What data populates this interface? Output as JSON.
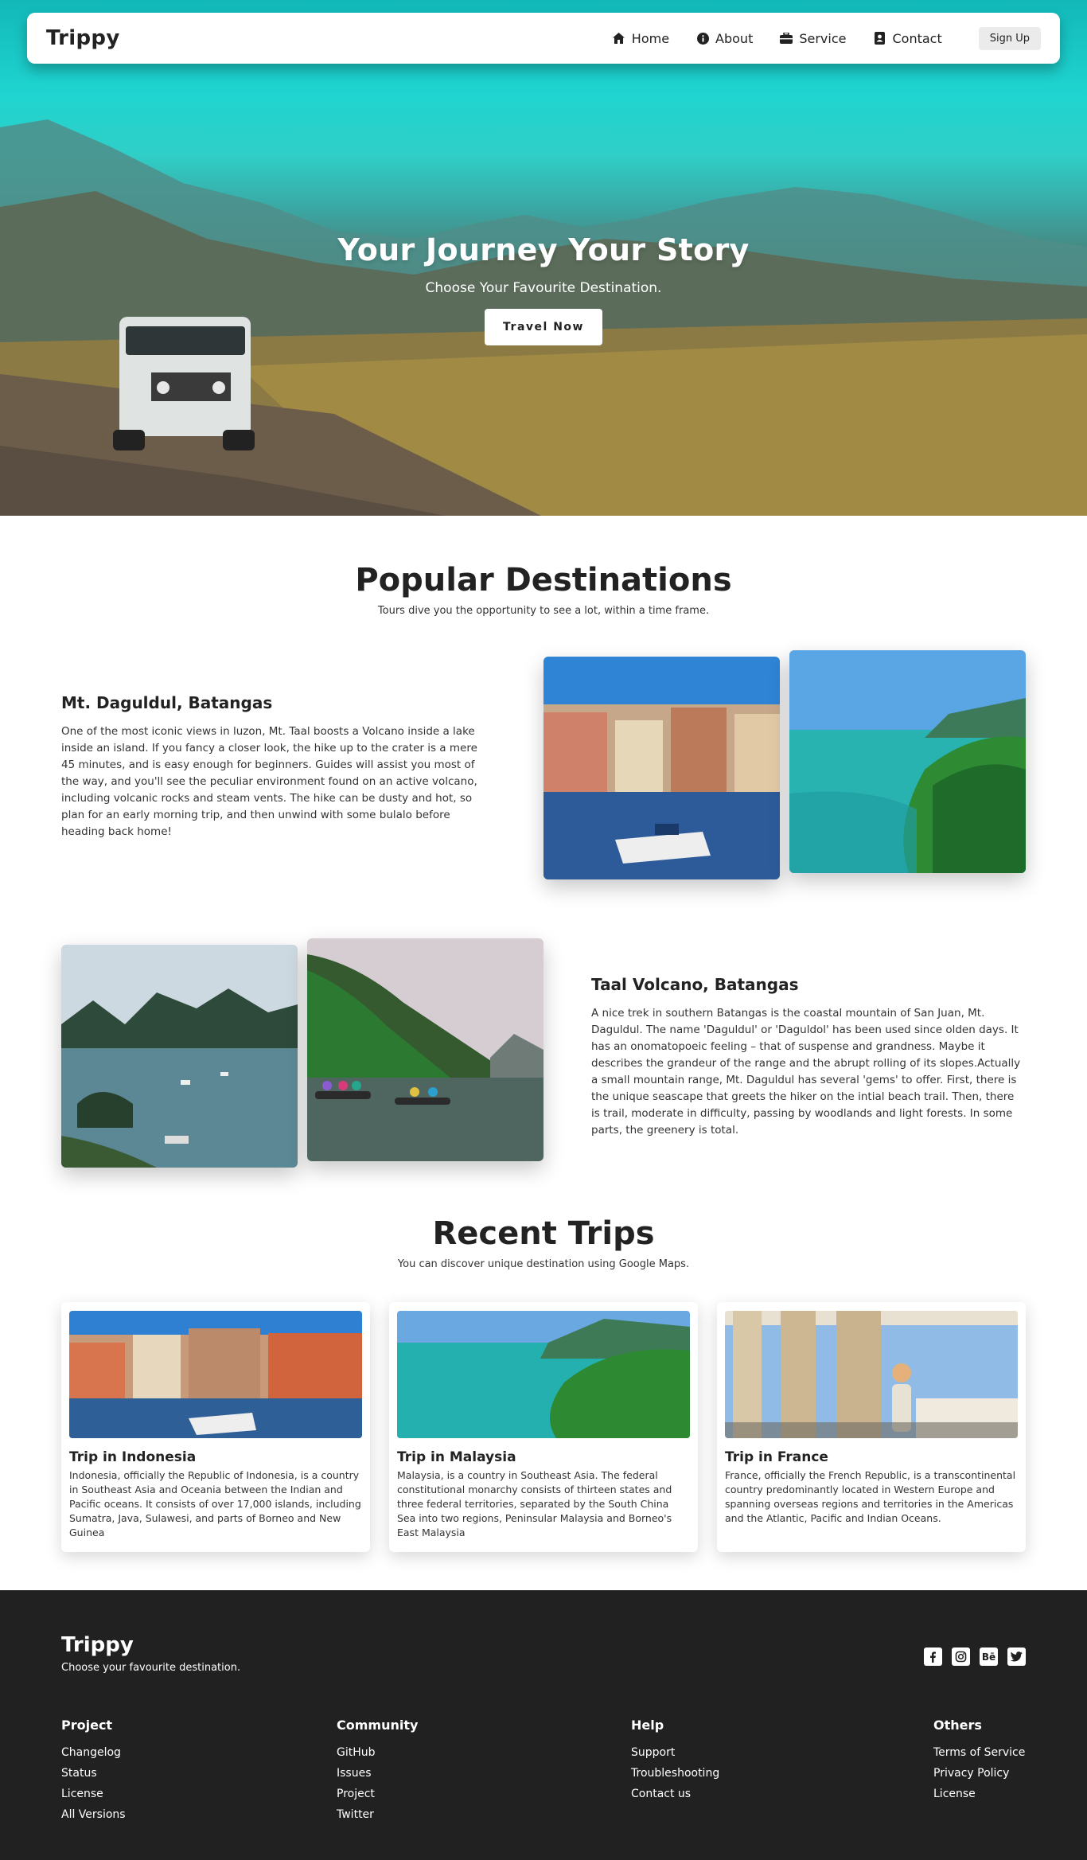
{
  "nav": {
    "brand": "Trippy",
    "links": [
      {
        "label": "Home",
        "icon": "home-icon"
      },
      {
        "label": "About",
        "icon": "info-icon"
      },
      {
        "label": "Service",
        "icon": "briefcase-icon"
      },
      {
        "label": "Contact",
        "icon": "contact-card-icon"
      }
    ],
    "signup": "Sign Up"
  },
  "hero": {
    "title": "Your Journey Your Story",
    "subtitle": "Choose Your Favourite Destination.",
    "cta": "Travel Now"
  },
  "popular": {
    "title": "Popular Destinations",
    "subtitle": "Tours dive you the opportunity to see a lot, within a time frame.",
    "destinations": [
      {
        "title": "Mt. Daguldul, Batangas",
        "description": "One of the most iconic views in luzon, Mt. Taal boosts a Volcano inside a lake inside an island. If you fancy a closer look, the hike up to the crater is a mere 45 minutes, and is easy enough for beginners. Guides will assist you most of the way, and you'll see the peculiar environment found on an active volcano, including volcanic rocks and steam vents. The hike can be dusty and hot, so plan for an early morning trip, and then unwind with some bulalo before heading back home!"
      },
      {
        "title": "Taal Volcano, Batangas",
        "description": "A nice trek in southern Batangas is the coastal mountain of San Juan, Mt. Daguldul. The name 'Daguldul' or 'Daguldol' has been used since olden days. It has an onomatopoeic feeling – that of suspense and grandness. Maybe it describes the grandeur of the range and the abrupt rolling of its slopes.Actually a small mountain range, Mt. Daguldul has several 'gems' to offer. First, there is the unique seascape that greets the hiker on the intial beach trail. Then, there is trail, moderate in difficulty, passing by woodlands and light forests. In some parts, the greenery is total."
      }
    ]
  },
  "recent": {
    "title": "Recent Trips",
    "subtitle": "You can discover unique destination using Google Maps.",
    "trips": [
      {
        "title": "Trip in Indonesia",
        "description": "Indonesia, officially the Republic of Indonesia, is a country in Southeast Asia and Oceania between the Indian and Pacific oceans. It consists of over 17,000 islands, including Sumatra, Java, Sulawesi, and parts of Borneo and New Guinea"
      },
      {
        "title": "Trip in Malaysia",
        "description": "Malaysia, is a country in Southeast Asia. The federal constitutional monarchy consists of thirteen states and three federal territories, separated by the South China Sea into two regions, Peninsular Malaysia and Borneo's East Malaysia"
      },
      {
        "title": "Trip in France",
        "description": "France, officially the French Republic, is a transcontinental country predominantly located in Western Europe and spanning overseas regions and territories in the Americas and the Atlantic, Pacific and Indian Oceans."
      }
    ]
  },
  "footer": {
    "brand": "Trippy",
    "tagline": "Choose your favourite destination.",
    "socials": [
      "facebook-icon",
      "instagram-icon",
      "behance-icon",
      "twitter-icon"
    ],
    "behance_text": "Bē",
    "columns": [
      {
        "title": "Project",
        "links": [
          "Changelog",
          "Status",
          "License",
          "All Versions"
        ]
      },
      {
        "title": "Community",
        "links": [
          "GitHub",
          "Issues",
          "Project",
          "Twitter"
        ]
      },
      {
        "title": "Help",
        "links": [
          "Support",
          "Troubleshooting",
          "Contact us"
        ]
      },
      {
        "title": "Others",
        "links": [
          "Terms of Service",
          "Privacy Policy",
          "License"
        ]
      }
    ]
  }
}
